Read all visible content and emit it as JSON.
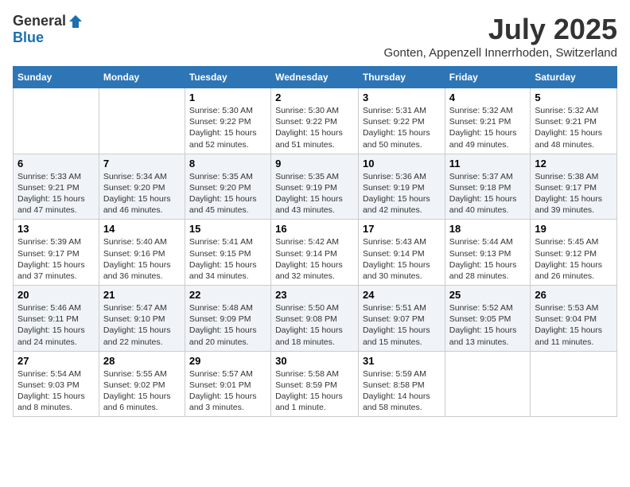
{
  "header": {
    "logo_general": "General",
    "logo_blue": "Blue",
    "month": "July 2025",
    "location": "Gonten, Appenzell Innerrhoden, Switzerland"
  },
  "days_of_week": [
    "Sunday",
    "Monday",
    "Tuesday",
    "Wednesday",
    "Thursday",
    "Friday",
    "Saturday"
  ],
  "weeks": [
    [
      {
        "day": "",
        "detail": ""
      },
      {
        "day": "",
        "detail": ""
      },
      {
        "day": "1",
        "detail": "Sunrise: 5:30 AM\nSunset: 9:22 PM\nDaylight: 15 hours\nand 52 minutes."
      },
      {
        "day": "2",
        "detail": "Sunrise: 5:30 AM\nSunset: 9:22 PM\nDaylight: 15 hours\nand 51 minutes."
      },
      {
        "day": "3",
        "detail": "Sunrise: 5:31 AM\nSunset: 9:22 PM\nDaylight: 15 hours\nand 50 minutes."
      },
      {
        "day": "4",
        "detail": "Sunrise: 5:32 AM\nSunset: 9:21 PM\nDaylight: 15 hours\nand 49 minutes."
      },
      {
        "day": "5",
        "detail": "Sunrise: 5:32 AM\nSunset: 9:21 PM\nDaylight: 15 hours\nand 48 minutes."
      }
    ],
    [
      {
        "day": "6",
        "detail": "Sunrise: 5:33 AM\nSunset: 9:21 PM\nDaylight: 15 hours\nand 47 minutes."
      },
      {
        "day": "7",
        "detail": "Sunrise: 5:34 AM\nSunset: 9:20 PM\nDaylight: 15 hours\nand 46 minutes."
      },
      {
        "day": "8",
        "detail": "Sunrise: 5:35 AM\nSunset: 9:20 PM\nDaylight: 15 hours\nand 45 minutes."
      },
      {
        "day": "9",
        "detail": "Sunrise: 5:35 AM\nSunset: 9:19 PM\nDaylight: 15 hours\nand 43 minutes."
      },
      {
        "day": "10",
        "detail": "Sunrise: 5:36 AM\nSunset: 9:19 PM\nDaylight: 15 hours\nand 42 minutes."
      },
      {
        "day": "11",
        "detail": "Sunrise: 5:37 AM\nSunset: 9:18 PM\nDaylight: 15 hours\nand 40 minutes."
      },
      {
        "day": "12",
        "detail": "Sunrise: 5:38 AM\nSunset: 9:17 PM\nDaylight: 15 hours\nand 39 minutes."
      }
    ],
    [
      {
        "day": "13",
        "detail": "Sunrise: 5:39 AM\nSunset: 9:17 PM\nDaylight: 15 hours\nand 37 minutes."
      },
      {
        "day": "14",
        "detail": "Sunrise: 5:40 AM\nSunset: 9:16 PM\nDaylight: 15 hours\nand 36 minutes."
      },
      {
        "day": "15",
        "detail": "Sunrise: 5:41 AM\nSunset: 9:15 PM\nDaylight: 15 hours\nand 34 minutes."
      },
      {
        "day": "16",
        "detail": "Sunrise: 5:42 AM\nSunset: 9:14 PM\nDaylight: 15 hours\nand 32 minutes."
      },
      {
        "day": "17",
        "detail": "Sunrise: 5:43 AM\nSunset: 9:14 PM\nDaylight: 15 hours\nand 30 minutes."
      },
      {
        "day": "18",
        "detail": "Sunrise: 5:44 AM\nSunset: 9:13 PM\nDaylight: 15 hours\nand 28 minutes."
      },
      {
        "day": "19",
        "detail": "Sunrise: 5:45 AM\nSunset: 9:12 PM\nDaylight: 15 hours\nand 26 minutes."
      }
    ],
    [
      {
        "day": "20",
        "detail": "Sunrise: 5:46 AM\nSunset: 9:11 PM\nDaylight: 15 hours\nand 24 minutes."
      },
      {
        "day": "21",
        "detail": "Sunrise: 5:47 AM\nSunset: 9:10 PM\nDaylight: 15 hours\nand 22 minutes."
      },
      {
        "day": "22",
        "detail": "Sunrise: 5:48 AM\nSunset: 9:09 PM\nDaylight: 15 hours\nand 20 minutes."
      },
      {
        "day": "23",
        "detail": "Sunrise: 5:50 AM\nSunset: 9:08 PM\nDaylight: 15 hours\nand 18 minutes."
      },
      {
        "day": "24",
        "detail": "Sunrise: 5:51 AM\nSunset: 9:07 PM\nDaylight: 15 hours\nand 15 minutes."
      },
      {
        "day": "25",
        "detail": "Sunrise: 5:52 AM\nSunset: 9:05 PM\nDaylight: 15 hours\nand 13 minutes."
      },
      {
        "day": "26",
        "detail": "Sunrise: 5:53 AM\nSunset: 9:04 PM\nDaylight: 15 hours\nand 11 minutes."
      }
    ],
    [
      {
        "day": "27",
        "detail": "Sunrise: 5:54 AM\nSunset: 9:03 PM\nDaylight: 15 hours\nand 8 minutes."
      },
      {
        "day": "28",
        "detail": "Sunrise: 5:55 AM\nSunset: 9:02 PM\nDaylight: 15 hours\nand 6 minutes."
      },
      {
        "day": "29",
        "detail": "Sunrise: 5:57 AM\nSunset: 9:01 PM\nDaylight: 15 hours\nand 3 minutes."
      },
      {
        "day": "30",
        "detail": "Sunrise: 5:58 AM\nSunset: 8:59 PM\nDaylight: 15 hours\nand 1 minute."
      },
      {
        "day": "31",
        "detail": "Sunrise: 5:59 AM\nSunset: 8:58 PM\nDaylight: 14 hours\nand 58 minutes."
      },
      {
        "day": "",
        "detail": ""
      },
      {
        "day": "",
        "detail": ""
      }
    ]
  ]
}
